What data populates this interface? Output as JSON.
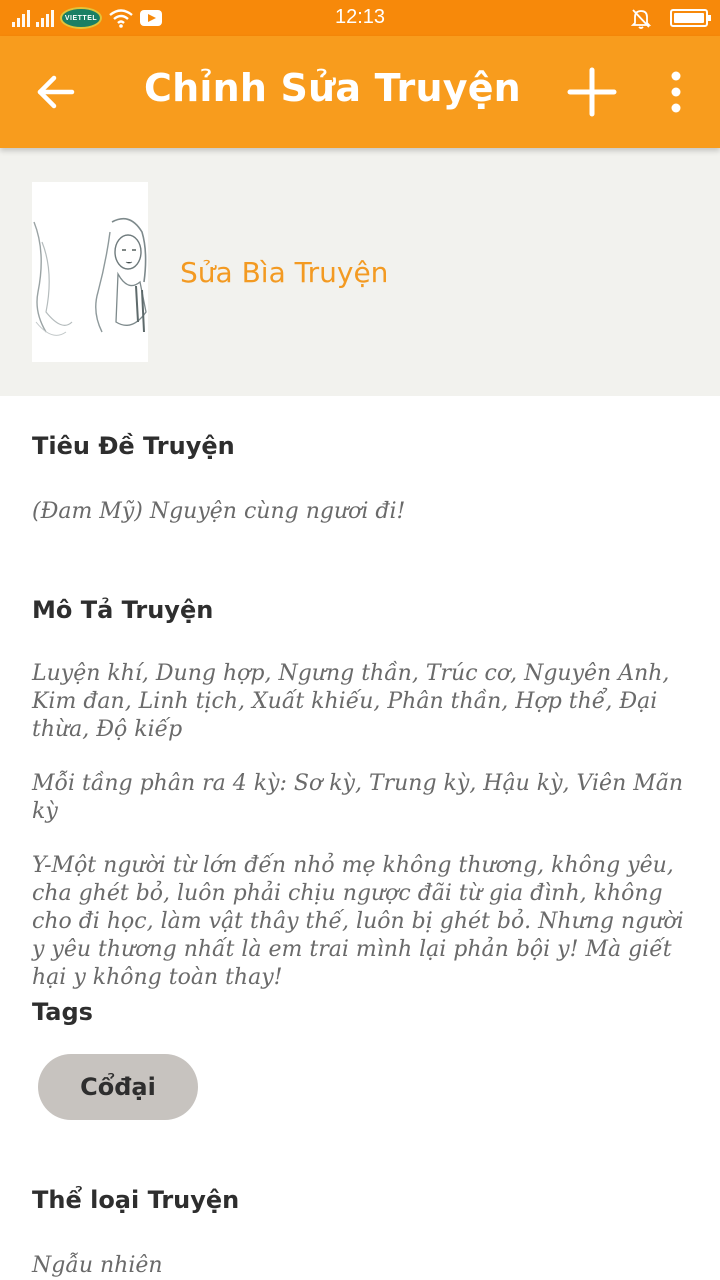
{
  "status_bar": {
    "carrier_logo": "viettel",
    "time": "12:13"
  },
  "app_bar": {
    "title": "Chỉnh Sửa Truyện",
    "back_icon": "arrow-left-icon",
    "add_icon": "plus-icon",
    "more_icon": "more-vertical-icon"
  },
  "cover": {
    "edit_label": "Sửa Bìa Truyện"
  },
  "form": {
    "title_label": "Tiêu Đề Truyện",
    "title_value": "(Đam Mỹ) Nguyện cùng ngươi đi!",
    "description_label": "Mô Tả Truyện",
    "description_paragraphs": [
      "Luyện khí, Dung hợp, Ngưng thần, Trúc cơ, Nguyên Anh, Kim đan, Linh tịch, Xuất khiếu, Phân thần, Hợp thể, Đại thừa, Độ kiếp",
      "Mỗi tầng phân ra 4 kỳ: Sơ kỳ, Trung kỳ, Hậu kỳ, Viên Mãn kỳ",
      "Y-Một người từ lớn đến nhỏ mẹ không thương, không yêu, cha ghét bỏ, luôn phải chịu ngược đãi từ gia đình, không cho đi học, làm vật thây thế, luôn bị ghét bỏ. Nhưng người y yêu thương nhất là em trai mình lại phản bội y! Mà giết hại y không toàn thay!"
    ],
    "tags_label": "Tags",
    "tags": [
      "Cổđại"
    ],
    "genre_label": "Thể loại Truyện",
    "genre_value": "Ngẫu nhiên"
  },
  "colors": {
    "status_bar": "#f7890a",
    "app_bar": "#f89c1d",
    "accent_text": "#f39a22",
    "cover_bg": "#f2f2ee",
    "tag_chip": "#c7c3bf"
  }
}
